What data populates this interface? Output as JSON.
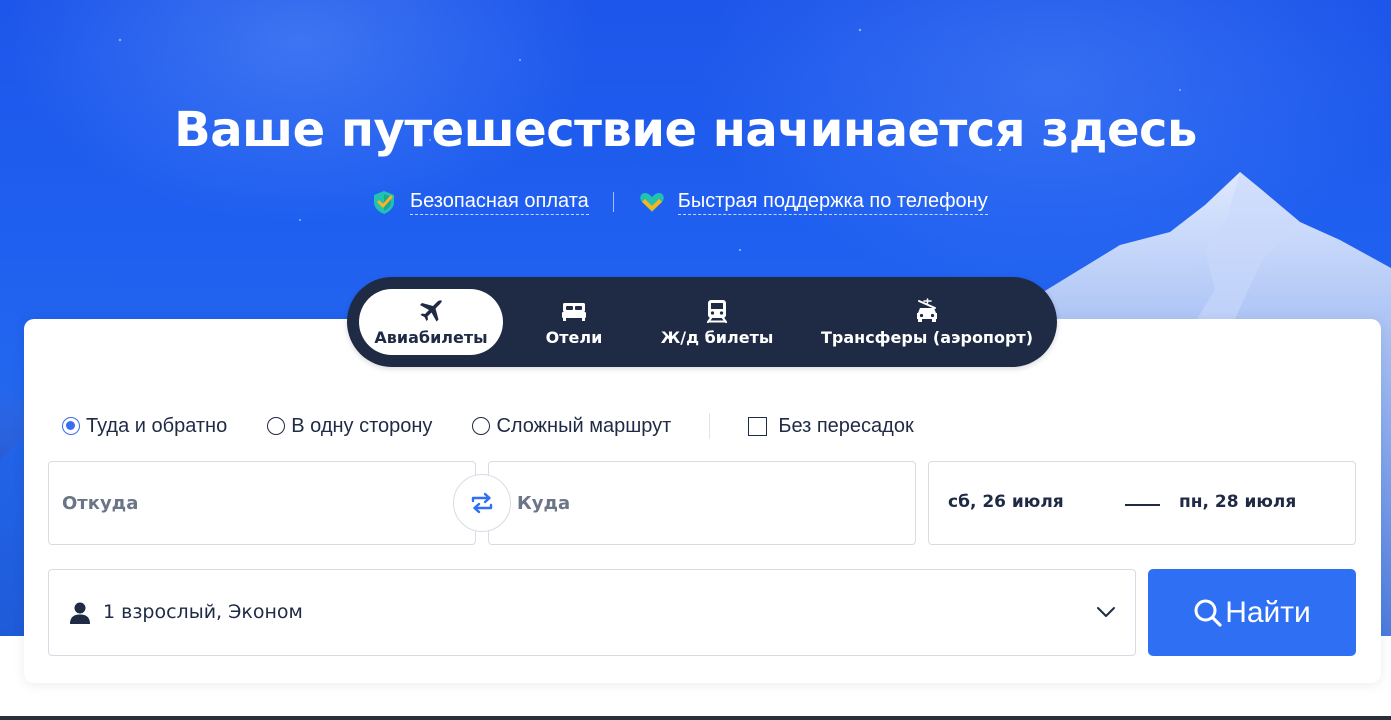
{
  "hero": {
    "title": "Ваше путешествие начинается здесь",
    "features": [
      {
        "label": "Безопасная оплата",
        "icon": "shield-check-icon"
      },
      {
        "label": "Быстрая поддержка по телефону",
        "icon": "support-heart-icon"
      }
    ]
  },
  "tabs": [
    {
      "label": "Авиабилеты",
      "icon": "airplane-icon",
      "active": true
    },
    {
      "label": "Отели",
      "icon": "bed-icon",
      "active": false
    },
    {
      "label": "Ж/д билеты",
      "icon": "train-icon",
      "active": false
    },
    {
      "label": "Трансферы (аэропорт)",
      "icon": "car-transfer-icon",
      "active": false
    }
  ],
  "trip_options": {
    "round_trip": "Туда и обратно",
    "one_way": "В одну сторону",
    "multi_city": "Сложный маршрут",
    "selected": "round_trip",
    "nonstop_label": "Без пересадок",
    "nonstop_checked": false
  },
  "search": {
    "from_placeholder": "Откуда",
    "to_placeholder": "Куда",
    "departure_date": "сб, 26 июля",
    "return_date": "пн, 28 июля",
    "passengers": "1 взрослый, Эконом",
    "button_label": "Найти"
  },
  "colors": {
    "accent": "#2f6ff4",
    "tab_bar": "#1f2a44",
    "text": "#1f2a44",
    "placeholder": "#6b7587"
  }
}
